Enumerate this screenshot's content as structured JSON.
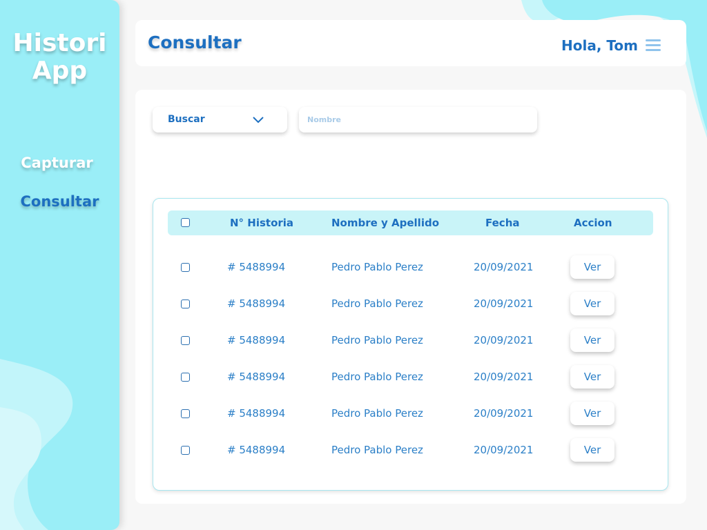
{
  "app": {
    "brand_line1": "Histori",
    "brand_line2": "App"
  },
  "sidebar": {
    "items": [
      {
        "label": "Capturar"
      },
      {
        "label": "Consultar"
      }
    ]
  },
  "header": {
    "title": "Consultar",
    "greeting": "Hola, Tom"
  },
  "search": {
    "select_value": "Buscar",
    "name_placeholder": "Nombre"
  },
  "table": {
    "columns": [
      "N° Historia",
      "Nombre y Apellido",
      "Fecha",
      "Accion"
    ],
    "rows": [
      {
        "historia": "# 5488994",
        "nombre": "Pedro Pablo Perez",
        "fecha": "20/09/2021",
        "accion": "Ver"
      },
      {
        "historia": "# 5488994",
        "nombre": "Pedro Pablo Perez",
        "fecha": "20/09/2021",
        "accion": "Ver"
      },
      {
        "historia": "# 5488994",
        "nombre": "Pedro Pablo Perez",
        "fecha": "20/09/2021",
        "accion": "Ver"
      },
      {
        "historia": "# 5488994",
        "nombre": "Pedro Pablo Perez",
        "fecha": "20/09/2021",
        "accion": "Ver"
      },
      {
        "historia": "# 5488994",
        "nombre": "Pedro Pablo Perez",
        "fecha": "20/09/2021",
        "accion": "Ver"
      },
      {
        "historia": "# 5488994",
        "nombre": "Pedro Pablo Perez",
        "fecha": "20/09/2021",
        "accion": "Ver"
      }
    ]
  },
  "icons": {
    "menu": "hamburger-icon",
    "select": "chevron-down-icon"
  },
  "colors": {
    "accent": "#1d6fc0",
    "sidebar": "#9aeef7",
    "table_header": "#c9f4f8",
    "light_cyan": "#c7f6fa"
  }
}
